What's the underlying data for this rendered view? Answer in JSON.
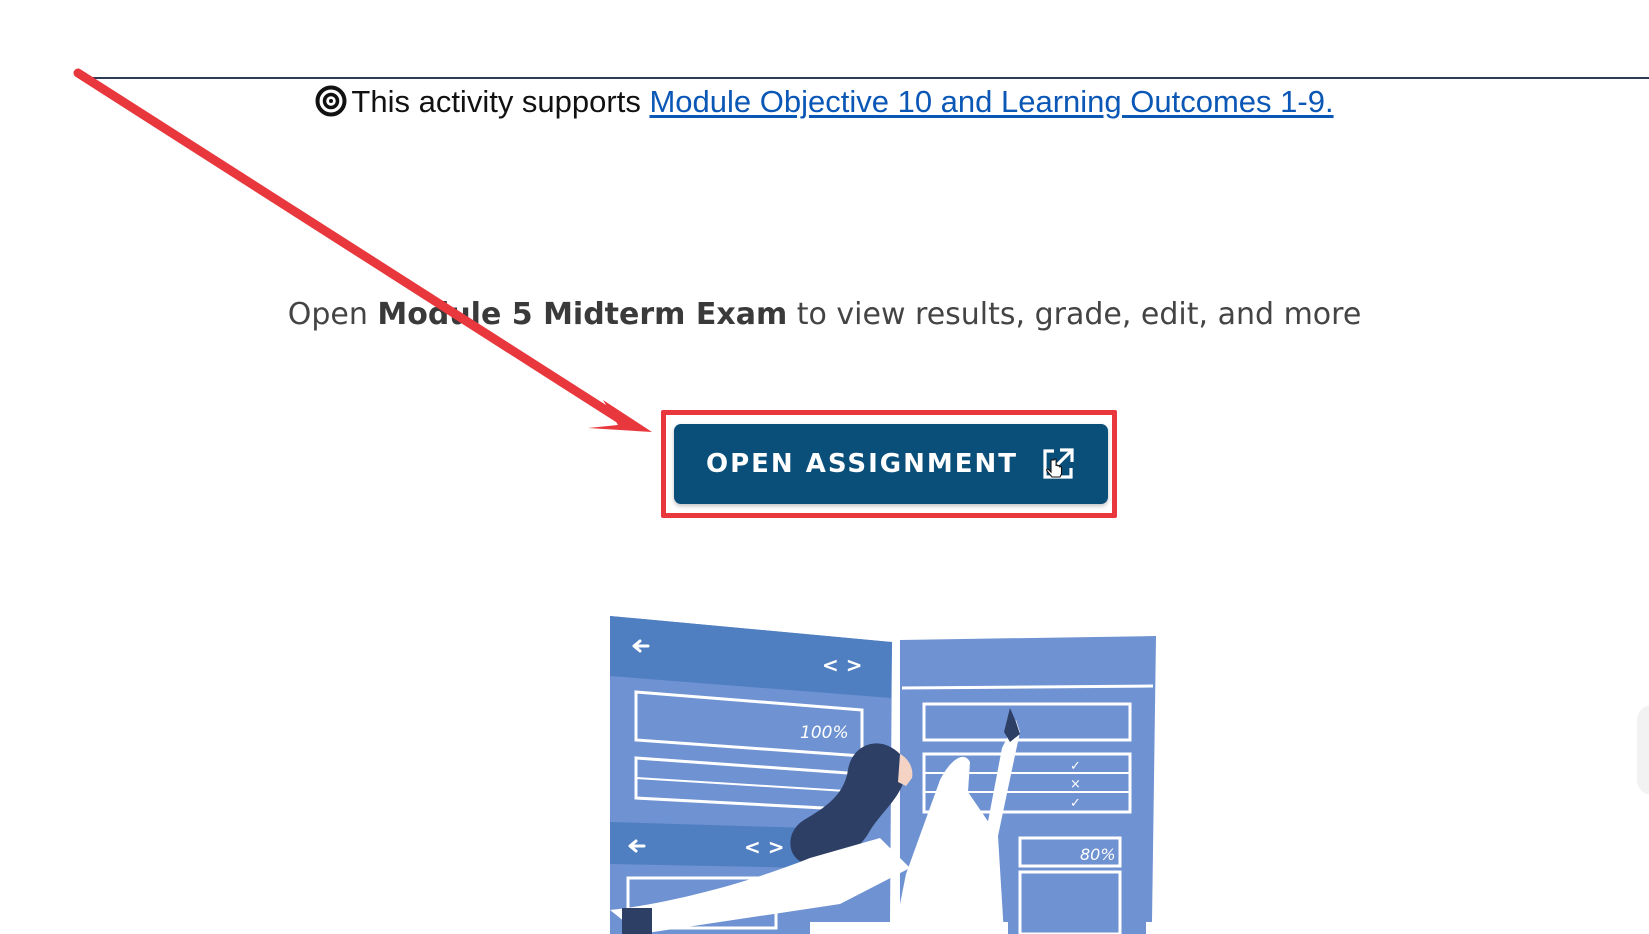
{
  "objective": {
    "prefix": "This activity supports ",
    "link_text": "Module Objective 10 and Learning Outcomes 1-9.",
    "icon": "target-icon"
  },
  "open_line": {
    "lead": "Open ",
    "exam_name": "Module 5 Midterm Exam",
    "trail": " to view results, grade, edit, and more"
  },
  "button": {
    "label": "OPEN ASSIGNMENT",
    "icon": "external-link-icon"
  },
  "illustration": {
    "panel_a_value": "100%",
    "panel_b_value": "80%",
    "nav_arrows": "< >",
    "check_marks": [
      "✓",
      "×",
      "✓"
    ]
  },
  "colors": {
    "button_bg": "#0a4f7a",
    "highlight": "#e8383d",
    "link": "#0b57b6",
    "illustration_blue": "#4f7fc1"
  }
}
